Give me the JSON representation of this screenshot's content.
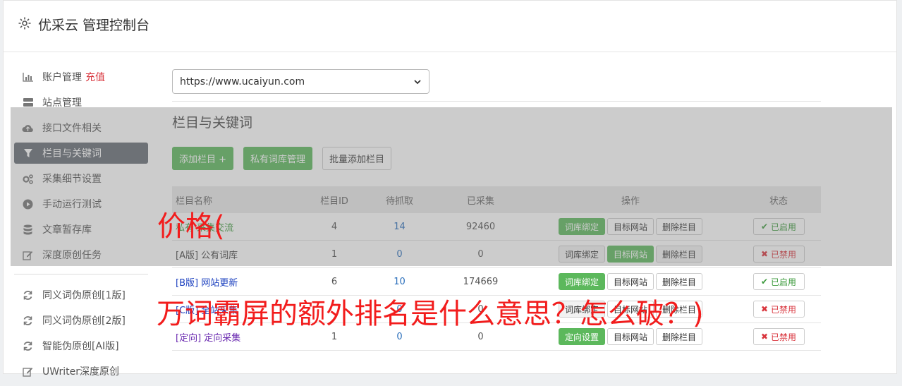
{
  "header": {
    "title": "优采云 管理控制台",
    "icon": "gear-icon"
  },
  "sidebar": {
    "items": [
      {
        "label": "账户管理",
        "badge": "充值",
        "icon": "bar-chart-icon"
      },
      {
        "label": "站点管理",
        "icon": "server-icon"
      },
      {
        "label": "接口文件相关",
        "icon": "cloud-upload-icon"
      },
      {
        "label": "栏目与关键词",
        "icon": "filter-icon",
        "active": true
      },
      {
        "label": "采集细节设置",
        "icon": "cogs-icon"
      },
      {
        "label": "手动运行测试",
        "icon": "play-circle-icon"
      },
      {
        "label": "文章暂存库",
        "icon": "database-icon"
      },
      {
        "label": "深度原创任务",
        "icon": "edit-icon"
      }
    ],
    "items2": [
      {
        "label": "同义词伪原创[1版]",
        "icon": "refresh-icon"
      },
      {
        "label": "同义词伪原创[2版]",
        "icon": "refresh-icon"
      },
      {
        "label": "智能伪原创[AI版]",
        "icon": "refresh-icon"
      },
      {
        "label": "UWriter深度原创",
        "icon": "edit-icon"
      }
    ]
  },
  "main": {
    "site_select": "https://www.ucaiyun.com",
    "section_title": "栏目与关键词",
    "buttons": {
      "add": "添加栏目 +",
      "private": "私有词库管理",
      "batch": "批量添加栏目"
    },
    "columns": [
      "栏目名称",
      "栏目ID",
      "待抓取",
      "已采集",
      "操作",
      "状态"
    ],
    "rows": [
      {
        "name": "私有 采集交流",
        "id": "4",
        "pending": "14",
        "done": "92460",
        "op1": "词库绑定",
        "op2": "目标网站",
        "op3": "删除栏目",
        "status": "已启用"
      },
      {
        "name": "[A版] 公有词库",
        "id": "1",
        "pending": "0",
        "done": "0",
        "op1": "词库绑定",
        "op2": "目标网站",
        "op3": "删除栏目",
        "status": "已禁用"
      },
      {
        "name": "[B版] 网站更新",
        "id": "6",
        "pending": "10",
        "done": "174669",
        "op1": "词库绑定",
        "op2": "目标网站",
        "op3": "删除栏目",
        "status": "已启用"
      },
      {
        "name": "[C版] 全站采集",
        "id": "",
        "pending": "0",
        "done": "0",
        "op1": "词库绑定",
        "op2": "目标网站",
        "op3": "删除栏目",
        "status": "已禁用"
      },
      {
        "name": "[定向] 定向采集",
        "id": "1",
        "pending": "0",
        "done": "0",
        "op1": "定向设置",
        "op2": "目标网站",
        "op3": "删除栏目",
        "status": "已禁用"
      }
    ]
  },
  "watermark": {
    "line1": "价格(",
    "line2": "万词霸屏的额外排名是什么意思？怎么破？)"
  },
  "colors": {
    "accent_green": "#5cb85c",
    "active_sidebar": "#666c74",
    "danger": "#d9363e",
    "watermark": "#f21c1c"
  }
}
